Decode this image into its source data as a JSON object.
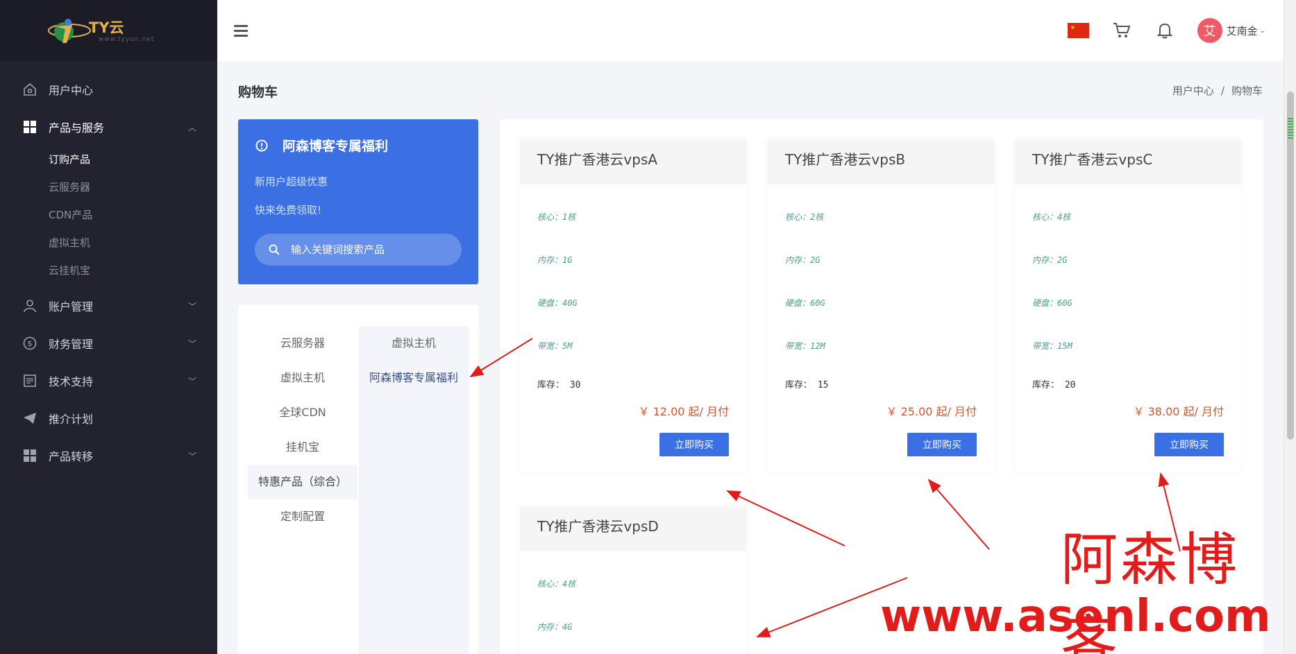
{
  "logo": {
    "text": "TY云",
    "sub": "www.tyyun.net"
  },
  "sidebar": {
    "items": [
      {
        "label": "用户中心",
        "icon": "home-icon"
      },
      {
        "label": "产品与服务",
        "icon": "grid-icon",
        "expanded": true,
        "children": [
          "订购产品",
          "云服务器",
          "CDN产品",
          "虚拟主机",
          "云挂机宝"
        ]
      },
      {
        "label": "账户管理",
        "icon": "user-icon"
      },
      {
        "label": "财务管理",
        "icon": "dollar-icon"
      },
      {
        "label": "技术支持",
        "icon": "document-icon"
      },
      {
        "label": "推介计划",
        "icon": "paper-plane-icon"
      },
      {
        "label": "产品转移",
        "icon": "grid-icon"
      }
    ]
  },
  "topbar": {
    "username": "艾南金",
    "avatar_initial": "艾"
  },
  "page": {
    "title": "购物车",
    "breadcrumb": [
      "用户中心",
      "购物车"
    ]
  },
  "promo": {
    "title": "阿森博客专属福利",
    "line1": "新用户超级优惠",
    "line2": "快来免费领取!",
    "search_placeholder": "输入关键词搜索产品"
  },
  "categories": {
    "primary": [
      "云服务器",
      "虚拟主机",
      "全球CDN",
      "挂机宝",
      "特惠产品（综合）",
      "定制配置"
    ],
    "primary_selected": 4,
    "secondary": [
      "虚拟主机",
      "阿森博客专属福利"
    ]
  },
  "products": [
    {
      "name": "TY推广香港云vpsA",
      "specs": [
        "核心：1核",
        "内存：1G",
        "硬盘：40G",
        "带宽：5M"
      ],
      "stock_label": "库存：",
      "stock": "30",
      "price": "￥ 12.00 起/ 月付",
      "button": "立即购买"
    },
    {
      "name": "TY推广香港云vpsB",
      "specs": [
        "核心：2核",
        "内存：2G",
        "硬盘：60G",
        "带宽：12M"
      ],
      "stock_label": "库存：",
      "stock": "15",
      "price": "￥ 25.00 起/ 月付",
      "button": "立即购买"
    },
    {
      "name": "TY推广香港云vpsC",
      "specs": [
        "核心：4核",
        "内存：2G",
        "硬盘：60G",
        "带宽：15M"
      ],
      "stock_label": "库存：",
      "stock": "20",
      "price": "￥ 38.00 起/ 月付",
      "button": "立即购买"
    },
    {
      "name": "TY推广香港云vpsD",
      "specs": [
        "核心：4核",
        "内存：4G"
      ]
    }
  ],
  "watermark": {
    "cn": "阿森博客",
    "url": "www.asenl.com"
  },
  "colors": {
    "accent": "#3a70e3",
    "sidebar_bg": "#22232f",
    "price": "#d4582a",
    "annotation": "#e21b1b"
  }
}
